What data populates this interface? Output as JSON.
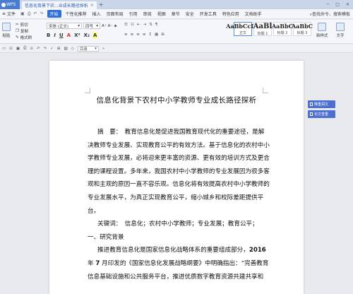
{
  "titlebar": {
    "app_name": "WPS",
    "doc_tab": "信息化背景下农...业成长路径探析",
    "tab_close": "×",
    "new_tab": "+"
  },
  "menu": {
    "file": "文件",
    "start": "开始",
    "items": [
      "插入",
      "页面布局",
      "引用",
      "审阅",
      "视图",
      "章节",
      "安全",
      "开发工具",
      "特色应用",
      "文档助手"
    ],
    "right": [
      "查找命令、搜索模板"
    ],
    "leading_item": "个性化推荐"
  },
  "ribbon": {
    "paste": "粘贴",
    "cut": "剪切",
    "copy": "复制",
    "format_painter": "格式刷",
    "font": "宋体 (正文)",
    "size": "四号",
    "styles": [
      {
        "preview": "AaBbCcDd",
        "caption": "正文"
      },
      {
        "preview": "AaBl",
        "caption": "标题 1"
      },
      {
        "preview": "AaBbC",
        "caption": "标题 2"
      },
      {
        "preview": "AaBbC",
        "caption": "标题 3"
      }
    ],
    "new_style": "新样式",
    "text_tools": "文字"
  },
  "qat": {
    "style_box": "目录"
  },
  "side": {
    "check": "降重润文",
    "layout": "论文查重"
  },
  "document": {
    "title": "信息化背景下农村中小学教师专业成长路径探析",
    "lines": [
      "摘　要：　教育信息化是促进我国教育现代化的重要途径，是解",
      "决教师专业发展、实现教育公平的有效方法。基于信息化的农村中小",
      "学教师专业发展，必将迎来更丰富的资源、更有效的培训方式及更合",
      "理的课程设置。多年来，我国农村中小学教师的专业发展因为很多客",
      "观和主观的原因一直不容乐观。信息化将有效提高农村中小学教师的",
      "专业发展水平，为真正实现教育公平，缩小城乡和校际差距提供平",
      "台。"
    ],
    "keywords": "关键词：　信息化；农村中小学教师；专业发展；教育公平；",
    "section1": "一、研究背景",
    "para2a": "推进教育信息化是国家信息化战略体系的重要组成部分，",
    "para2a_bold": "2016",
    "para2b_pre": "年 ",
    "para2b_bold": "7",
    "para2b_post": " 月印发的《国家信息化发展战略纲要》中明确指出：“完善教育",
    "para2c": "信息基础设施和公共服务平台，推进优质数字教育资源共建共享和"
  }
}
